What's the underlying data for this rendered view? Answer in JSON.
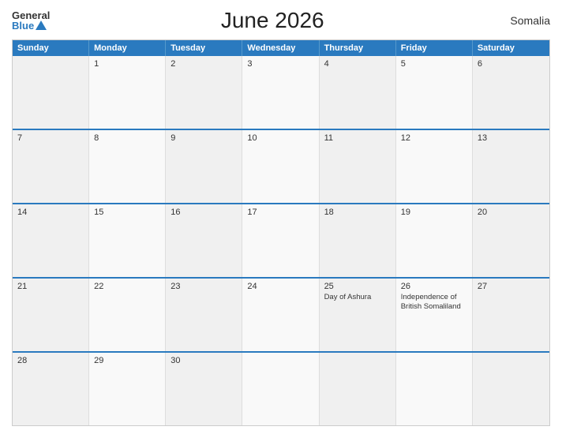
{
  "header": {
    "logo_general": "General",
    "logo_blue": "Blue",
    "title": "June 2026",
    "country": "Somalia"
  },
  "calendar": {
    "days_of_week": [
      "Sunday",
      "Monday",
      "Tuesday",
      "Wednesday",
      "Thursday",
      "Friday",
      "Saturday"
    ],
    "weeks": [
      [
        {
          "day": "",
          "event": ""
        },
        {
          "day": "1",
          "event": ""
        },
        {
          "day": "2",
          "event": ""
        },
        {
          "day": "3",
          "event": ""
        },
        {
          "day": "4",
          "event": ""
        },
        {
          "day": "5",
          "event": ""
        },
        {
          "day": "6",
          "event": ""
        }
      ],
      [
        {
          "day": "7",
          "event": ""
        },
        {
          "day": "8",
          "event": ""
        },
        {
          "day": "9",
          "event": ""
        },
        {
          "day": "10",
          "event": ""
        },
        {
          "day": "11",
          "event": ""
        },
        {
          "day": "12",
          "event": ""
        },
        {
          "day": "13",
          "event": ""
        }
      ],
      [
        {
          "day": "14",
          "event": ""
        },
        {
          "day": "15",
          "event": ""
        },
        {
          "day": "16",
          "event": ""
        },
        {
          "day": "17",
          "event": ""
        },
        {
          "day": "18",
          "event": ""
        },
        {
          "day": "19",
          "event": ""
        },
        {
          "day": "20",
          "event": ""
        }
      ],
      [
        {
          "day": "21",
          "event": ""
        },
        {
          "day": "22",
          "event": ""
        },
        {
          "day": "23",
          "event": ""
        },
        {
          "day": "24",
          "event": ""
        },
        {
          "day": "25",
          "event": "Day of Ashura"
        },
        {
          "day": "26",
          "event": "Independence of British Somaliland"
        },
        {
          "day": "27",
          "event": ""
        }
      ],
      [
        {
          "day": "28",
          "event": ""
        },
        {
          "day": "29",
          "event": ""
        },
        {
          "day": "30",
          "event": ""
        },
        {
          "day": "",
          "event": ""
        },
        {
          "day": "",
          "event": ""
        },
        {
          "day": "",
          "event": ""
        },
        {
          "day": "",
          "event": ""
        }
      ]
    ]
  }
}
